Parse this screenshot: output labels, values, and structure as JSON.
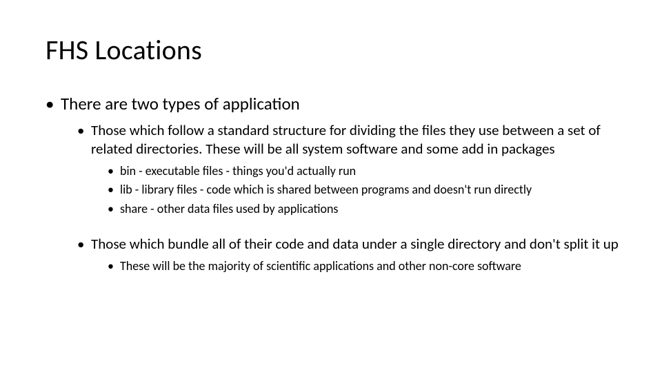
{
  "title": "FHS Locations",
  "bullets": {
    "lvl1": "There are two types of application",
    "lvl2a": "Those which follow a standard structure for dividing the files they use between a set of related directories. These will be all system software and some add in packages",
    "lvl3a1": "bin - executable files - things you'd actually run",
    "lvl3a2": "lib - library files - code which is shared between programs and doesn't run directly",
    "lvl3a3": "share - other data files used by applications",
    "lvl2b": "Those which bundle all of their code and data under a single directory and don't split it up",
    "lvl3b1": "These will be the majority of scientific applications and other non-core software"
  }
}
